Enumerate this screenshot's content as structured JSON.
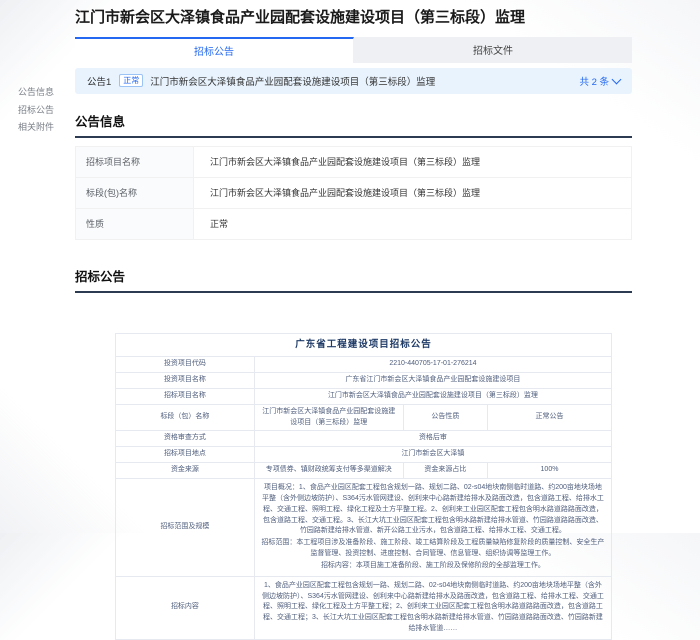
{
  "page": {
    "title": "江门市新会区大泽镇食品产业园配套设施建设项目（第三标段）监理"
  },
  "tabs": [
    {
      "label": "招标公告",
      "active": true
    },
    {
      "label": "招标文件",
      "active": false
    }
  ],
  "sidebar": {
    "items": [
      {
        "label": "公告信息"
      },
      {
        "label": "招标公告"
      },
      {
        "label": "相关附件"
      }
    ]
  },
  "announcement_bar": {
    "index_label": "公告1",
    "status_badge": "正常",
    "title": "江门市新会区大泽镇食品产业园配套设施建设项目（第三标段）监理",
    "count_label": "共 2 条",
    "chevron_icon": "chevron-down"
  },
  "info_section": {
    "heading": "公告信息",
    "rows": [
      {
        "label": "招标项目名称",
        "value": "江门市新会区大泽镇食品产业园配套设施建设项目（第三标段）监理"
      },
      {
        "label": "标段(包)名称",
        "value": "江门市新会区大泽镇食品产业园配套设施建设项目（第三标段）监理"
      },
      {
        "label": "性质",
        "value": "正常"
      }
    ]
  },
  "notice_section": {
    "heading": "招标公告",
    "table": {
      "title": "广东省工程建设项目招标公告",
      "rows": [
        {
          "type": "pair",
          "label": "投资项目代码",
          "value": "2210-440705-17-01-276214"
        },
        {
          "type": "pair",
          "label": "投资项目名称",
          "value": "广东省江门市新会区大泽镇食品产业园配套设施建设项目"
        },
        {
          "type": "pair",
          "label": "招标项目名称",
          "value": "江门市新会区大泽镇食品产业园配套设施建设项目（第三标段）监理"
        },
        {
          "type": "quad",
          "label": "标段（包）名称",
          "value": "江门市新会区大泽镇食品产业园配套设施建设项目（第三标段）监理",
          "label2": "公告性质",
          "value2": "正常公告"
        },
        {
          "type": "pair",
          "label": "资格审查方式",
          "value": "资格后审"
        },
        {
          "type": "pair",
          "label": "招标项目地点",
          "value": "江门市新会区大泽镇"
        },
        {
          "type": "quad",
          "label": "资金来源",
          "value": "专项债券、镇财政统筹支付等多渠道解决",
          "label2": "资金来源占比",
          "value2": "100%"
        },
        {
          "type": "block",
          "label": "招标范围及规模",
          "paragraphs": [
            "项目概况：1、食品产业园区配套工程包含规划一路、规划二路、02-s04地块南侧临时道路、约200亩地块场地平整（含外侧边坡防护）、S364污水管网建设、创利来中心路新建给排水及路面改造，包含道路工程、给排水工程、交通工程、照明工程、绿化工程及土方平整工程。2、创利来工业园区配套工程包含明水路道路路面改造，包含道路工程、交通工程。3、长江大坑工业园区配套工程包含明水路新建给排水管道、竹园路道路路面改造、竹园路新建给排水管道、新开公路工业污水，包含道路工程、给排水工程、交通工程。",
            "招标范围：本工程项目涉及准备阶段、施工阶段、竣工结算阶段及工程质量缺陷修复阶段的质量控制、安全生产监督管理、投资控制、进度控制、合同管理、信息管理、组织协调等监理工作。",
            "招标内容：本项目施工准备阶段、施工阶段及保修阶段的全部监理工作。"
          ]
        },
        {
          "type": "block",
          "label": "招标内容",
          "paragraphs": [
            "1、食品产业园区配套工程包含规划一路、规划二路、02-s04地块南侧临时道路、约200亩地块场地平整（含外侧边坡防护）、S364污水管网建设、创利来中心路新建给排水及路面改造，包含道路工程、给排水工程、交通工程、照明工程、绿化工程及土方平整工程；2、创利来工业园区配套工程包含明水路道路路面改造，包含道路工程、交通工程；3、长江大坑工业园区配套工程包含明水路新建给排水管道、竹园路道路路面改造、竹园路新建给排水管道……"
          ]
        }
      ]
    }
  },
  "colors": {
    "accent_blue": "#2468f2",
    "bar_background": "#e8f3fd",
    "tab_inactive_background": "#eef0f3",
    "heading_underline": "#2c3a52",
    "table_title_navy": "#1f3b67",
    "table_text": "#4e5d7c"
  }
}
